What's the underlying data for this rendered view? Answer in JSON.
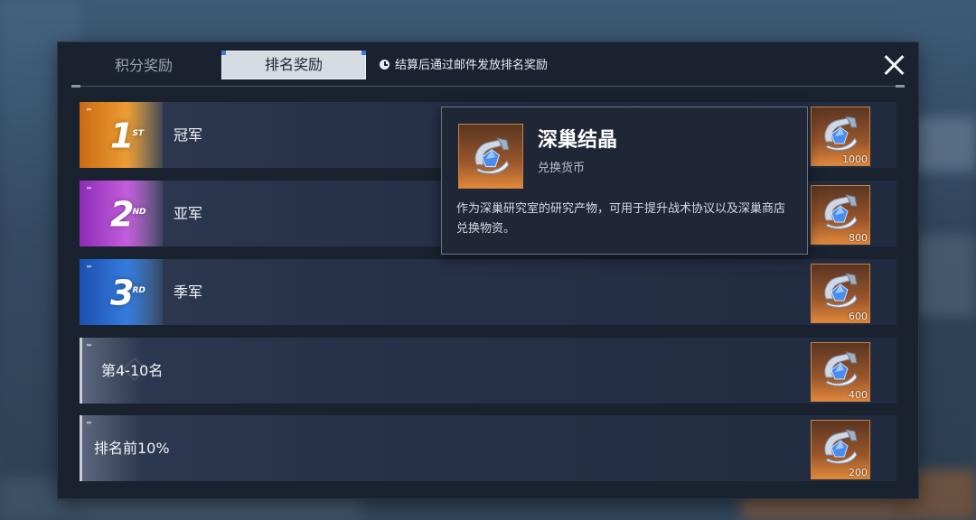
{
  "tabs": {
    "points_reward": "积分奖励",
    "rank_reward": "排名奖励"
  },
  "notice": "结算后通过邮件发放排名奖励",
  "rows": [
    {
      "rank_mark": "1",
      "rank_suffix": "ST",
      "label": "冠军",
      "reward_qty": "1000"
    },
    {
      "rank_mark": "2",
      "rank_suffix": "ND",
      "label": "亚军",
      "reward_qty": "800"
    },
    {
      "rank_mark": "3",
      "rank_suffix": "RD",
      "label": "季军",
      "reward_qty": "600"
    },
    {
      "label": "第4-10名",
      "reward_qty": "400"
    },
    {
      "label": "排名前10%",
      "reward_qty": "200"
    }
  ],
  "tooltip": {
    "title": "深巢结晶",
    "subtitle": "兑换货币",
    "description": "作为深巢研究室的研究产物，可用于提升战术协议以及深巢商店兑换物资。"
  },
  "colors": {
    "gold": "#f4a83b",
    "purple": "#d06ae6",
    "blue": "#3a86e8",
    "reward_bg": "#e0883b"
  }
}
